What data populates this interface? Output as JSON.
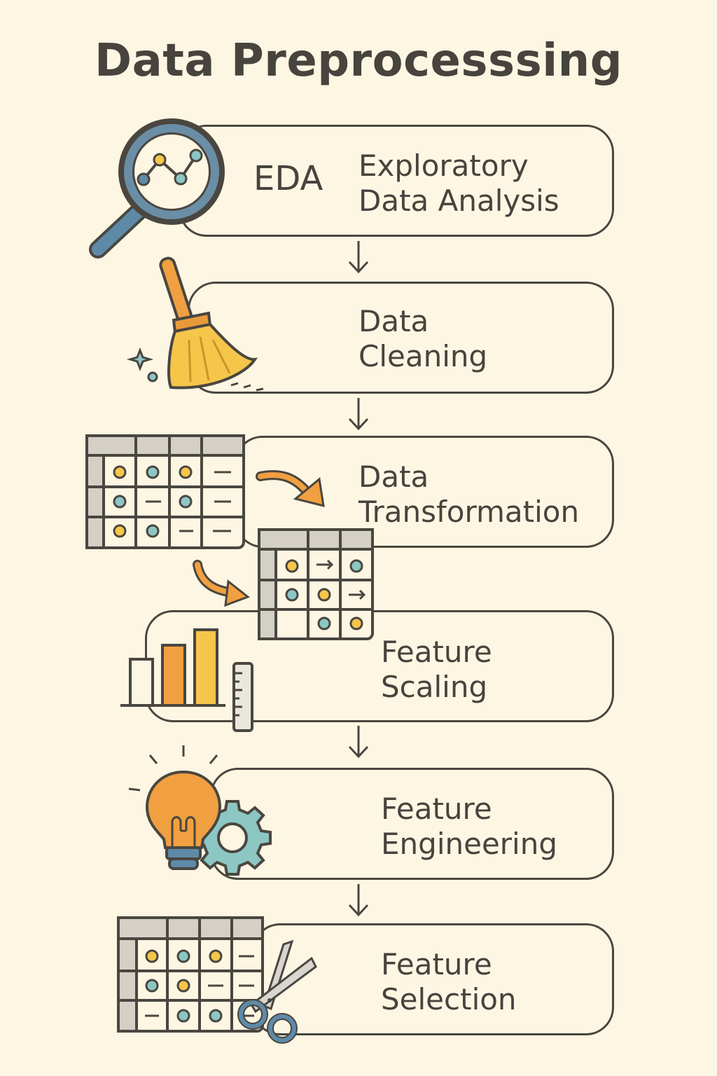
{
  "title": "Data Preprocesssing",
  "steps": [
    {
      "abbr": "EDA",
      "line1": "Exploratory",
      "line2": "Data Analysis",
      "icon": "magnifier-chart-icon"
    },
    {
      "line1": "Data",
      "line2": "Cleaning",
      "icon": "broom-icon"
    },
    {
      "line1": "Data",
      "line2": "Transformation",
      "icon": "table-transform-icon"
    },
    {
      "line1": "Feature",
      "line2": "Scaling",
      "icon": "bar-chart-ruler-icon"
    },
    {
      "line1": "Feature",
      "line2": "Engineering",
      "icon": "lightbulb-gear-icon"
    },
    {
      "line1": "Feature",
      "line2": "Selection",
      "icon": "table-scissors-icon"
    }
  ],
  "colors": {
    "background": "#fdf6e3",
    "outline": "#4a4640",
    "orange": "#f0a040",
    "yellow": "#f5c64a",
    "teal": "#8cc7c4",
    "blue": "#5e8aa8",
    "grey": "#d5d0c6"
  }
}
